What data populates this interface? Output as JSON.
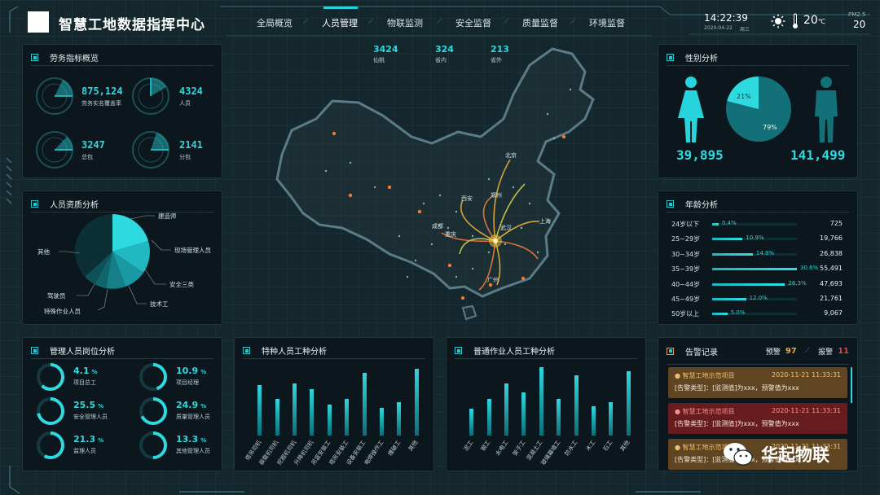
{
  "header": {
    "title": "智慧工地数据指挥中心",
    "time": "14:22:39",
    "date": "2020-04-22",
    "weekday": "周三",
    "temperature": "20",
    "temp_unit": "℃",
    "pm_label": "PM2.5",
    "pm_value": "20"
  },
  "nav": {
    "items": [
      "全局概览",
      "人员管理",
      "物联监测",
      "安全监督",
      "质量监督",
      "环境监督"
    ],
    "active": "人员管理"
  },
  "map_stats": [
    {
      "value": "3424",
      "label": "仙桃"
    },
    {
      "value": "324",
      "label": "省内"
    },
    {
      "value": "213",
      "label": "省外"
    }
  ],
  "map_cities": [
    "北京",
    "西安",
    "郑州",
    "成都",
    "上海",
    "重庆",
    "武汉",
    "广州"
  ],
  "labor": {
    "title": "劳务指标概览",
    "items": [
      {
        "value": "875,124",
        "label": "劳务实名覆盖率"
      },
      {
        "value": "4324",
        "label": "人员"
      },
      {
        "value": "3247",
        "label": "总包"
      },
      {
        "value": "2141",
        "label": "分包"
      }
    ]
  },
  "qualification": {
    "title": "人员资质分析",
    "labels": [
      "建造师",
      "现场管理人员",
      "安全三类",
      "技术工",
      "特殊作业人员",
      "驾驶员",
      "其他"
    ]
  },
  "management": {
    "title": "管理人员岗位分析",
    "items": [
      {
        "value": "4.1",
        "unit": "%",
        "label": "项目总工",
        "fraction": 0.62
      },
      {
        "value": "10.9",
        "unit": "%",
        "label": "项目经理",
        "fraction": 0.45
      },
      {
        "value": "25.5",
        "unit": "%",
        "label": "安全管理人员",
        "fraction": 0.72
      },
      {
        "value": "24.9",
        "unit": "%",
        "label": "质量管理人员",
        "fraction": 0.68
      },
      {
        "value": "21.3",
        "unit": "%",
        "label": "监理人员",
        "fraction": 0.58
      },
      {
        "value": "13.3",
        "unit": "%",
        "label": "其他管理人员",
        "fraction": 0.5
      }
    ]
  },
  "special_work": {
    "title": "特种人员工种分析",
    "categories": [
      "塔吊司机",
      "装载机司机",
      "挖掘机司机",
      "升降机司机",
      "吊篮安装工",
      "塔吊安装工",
      "设备安装工",
      "电焊操作工",
      "爆破工",
      "其他"
    ],
    "values": [
      0.72,
      0.52,
      0.75,
      0.66,
      0.44,
      0.52,
      0.9,
      0.4,
      0.48,
      0.95
    ]
  },
  "general_work": {
    "title": "普通作业人员工种分析",
    "categories": [
      "泥工",
      "钢工",
      "水电工",
      "架子工",
      "混凝土工",
      "玻璃幕墙工",
      "防水工",
      "木工",
      "石工",
      "其他"
    ],
    "values": [
      0.38,
      0.52,
      0.75,
      0.62,
      0.98,
      0.52,
      0.86,
      0.42,
      0.48,
      0.92
    ]
  },
  "gender": {
    "title": "性别分析",
    "female_pct": "21%",
    "male_pct": "79%",
    "female_fraction": 0.21,
    "female_count": "39,895",
    "male_count": "141,499"
  },
  "age": {
    "title": "年龄分析",
    "rows": [
      {
        "label": "24岁以下",
        "pct": "0.4%",
        "count": "725",
        "fraction": 0.04
      },
      {
        "label": "25~29岁",
        "pct": "10.9%",
        "count": "19,766",
        "fraction": 0.36
      },
      {
        "label": "30~34岁",
        "pct": "14.8%",
        "count": "26,838",
        "fraction": 0.48
      },
      {
        "label": "35~39岁",
        "pct": "30.6%",
        "count": "55,491",
        "fraction": 1.0
      },
      {
        "label": "40~44岁",
        "pct": "26.3%",
        "count": "47,693",
        "fraction": 0.86
      },
      {
        "label": "45~49岁",
        "pct": "12.0%",
        "count": "21,761",
        "fraction": 0.4
      },
      {
        "label": "50岁以上",
        "pct": "5.0%",
        "count": "9,067",
        "fraction": 0.18
      }
    ]
  },
  "alerts": {
    "title": "告警记录",
    "warn_label": "预警",
    "warn_count": "97",
    "alarm_label": "报警",
    "alarm_count": "11",
    "items": [
      {
        "name": "智慧工地示范项目",
        "time": "2020-11-21 11:33:31",
        "detail": "[告警类型]：[监测值]为xxx，预警值为xxx",
        "level": "warn"
      },
      {
        "name": "智慧工地示范项目",
        "time": "2020-11-21 11:33:31",
        "detail": "[告警类型]：[监测值]为xxx，预警值为xxx",
        "level": "alarm"
      },
      {
        "name": "智慧工地示范项目",
        "time": "2020-11-21 11:33:31",
        "detail": "[告警类型]：[监测值]为xxx，预警值为xxx",
        "level": "warn"
      }
    ]
  },
  "watermark": {
    "text": "华起物联"
  },
  "colors": {
    "accent": "#27d3dc",
    "warn": "#f0a640",
    "alarm": "#e04545",
    "background": "#14272c"
  }
}
